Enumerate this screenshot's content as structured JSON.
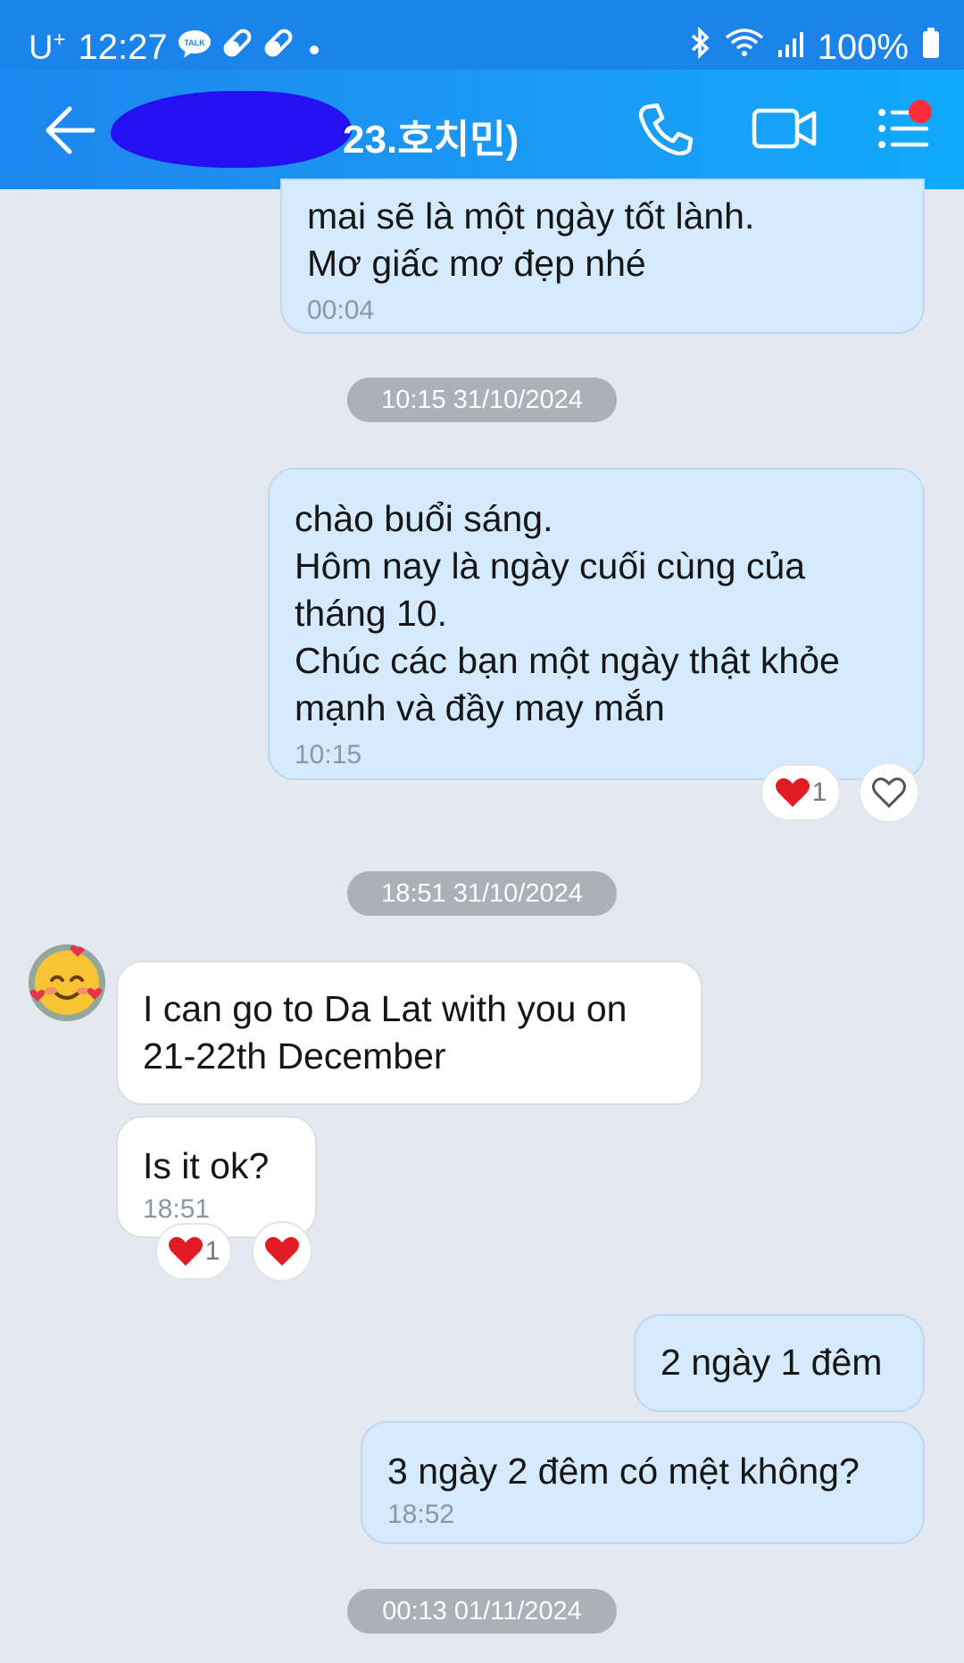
{
  "status_bar": {
    "carrier": "U",
    "carrier_sup": "+",
    "time": "12:27",
    "battery": "100%",
    "icons": [
      "talk-icon",
      "pill-icon",
      "pill-icon",
      "dot-icon",
      "bluetooth-icon",
      "wifi-icon",
      "signal-icon",
      "battery-icon"
    ]
  },
  "header": {
    "title": "23.호치민)",
    "accent": "#1b84ea"
  },
  "messages": [
    {
      "side": "me",
      "lines": [
        "mai sẽ là một ngày tốt lành.",
        "Mơ giấc mơ đẹp nhé"
      ],
      "time": "00:04"
    },
    {
      "type": "date",
      "text": "10:15 31/10/2024"
    },
    {
      "side": "me",
      "lines": [
        "chào buổi sáng.",
        "Hôm nay là ngày cuối cùng của",
        "tháng 10.",
        "Chúc các bạn một ngày thật khỏe",
        "mạnh và đầy may mắn"
      ],
      "time": "10:15",
      "reaction_count": "1"
    },
    {
      "type": "date",
      "text": "18:51 31/10/2024"
    },
    {
      "side": "other",
      "lines": [
        "I can go to Da Lat with you on",
        "21-22th December"
      ]
    },
    {
      "side": "other",
      "lines": [
        "Is it ok?"
      ],
      "time": "18:51",
      "reaction_count": "1"
    },
    {
      "side": "me",
      "lines": [
        "2 ngày 1 đêm"
      ]
    },
    {
      "side": "me",
      "lines": [
        "3 ngày 2 đêm có mệt không?"
      ],
      "time": "18:52"
    },
    {
      "type": "date",
      "text": "00:13 01/11/2024"
    }
  ]
}
